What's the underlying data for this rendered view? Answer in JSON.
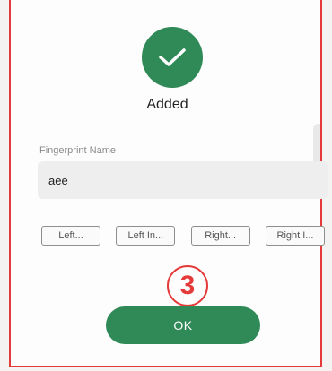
{
  "dialog": {
    "status_icon": "checkmark-icon",
    "status_text": "Added",
    "accent_color": "#2f8a57",
    "field": {
      "label": "Fingerprint Name",
      "value": "aee"
    },
    "suggestions": [
      {
        "label": "Left..."
      },
      {
        "label": "Left In..."
      },
      {
        "label": "Right..."
      },
      {
        "label": "Right I..."
      }
    ],
    "step_marker": "3",
    "step_marker_color": "#e53a3a",
    "ok_label": "OK"
  }
}
